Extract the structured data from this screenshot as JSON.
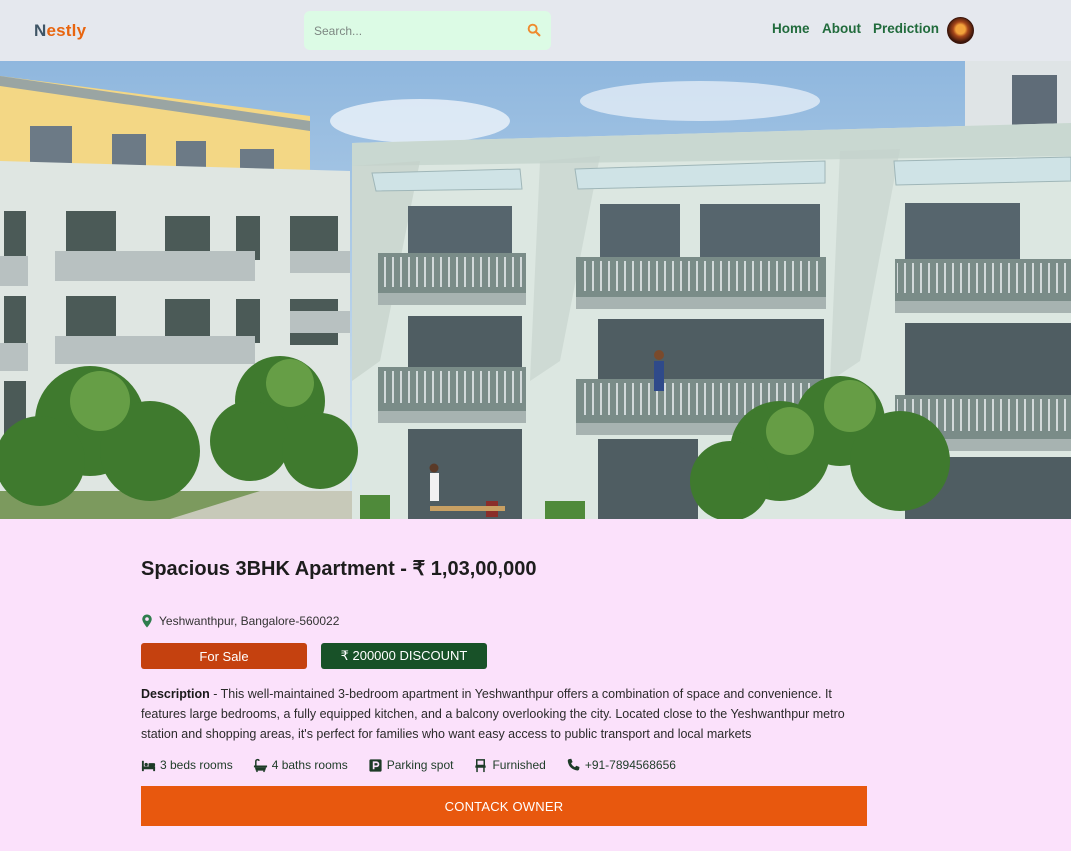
{
  "header": {
    "logo_first": "N",
    "logo_rest": "estly",
    "search": {
      "placeholder": "Search..."
    },
    "nav": {
      "home": "Home",
      "about": "About",
      "prediction": "Prediction"
    }
  },
  "listing": {
    "title": "Spacious 3BHK Apartment - ₹ 1,03,00,000",
    "location": "Yeshwanthpur, Bangalore-560022",
    "status_badge": "For Sale",
    "discount_badge": "₹ 200000 DISCOUNT",
    "description_label": "Description",
    "description_text": " - This well-maintained 3-bedroom apartment in Yeshwanthpur offers a combination of space and convenience. It features large bedrooms, a fully equipped kitchen, and a balcony overlooking the city. Located close to the Yeshwanthpur metro station and shopping areas, it's perfect for families who want easy access to public transport and local markets",
    "features": {
      "beds": "3 beds rooms",
      "baths": "4 baths rooms",
      "parking": "Parking spot",
      "furnished": "Furnished",
      "phone": "+91-7894568656"
    },
    "contact_button": "CONTACK OWNER"
  },
  "colors": {
    "page_bg": "#fbe1fb",
    "header_bg": "#e5e8ee",
    "accent_orange": "#e8580e",
    "sale_badge": "#c5410f",
    "discount_badge": "#185128",
    "nav_green": "#216b3c"
  },
  "icons": {
    "search": "search-icon",
    "location": "map-pin-icon",
    "beds": "bed-icon",
    "baths": "bath-icon",
    "parking": "parking-icon",
    "furnished": "chair-icon",
    "phone": "phone-icon"
  }
}
